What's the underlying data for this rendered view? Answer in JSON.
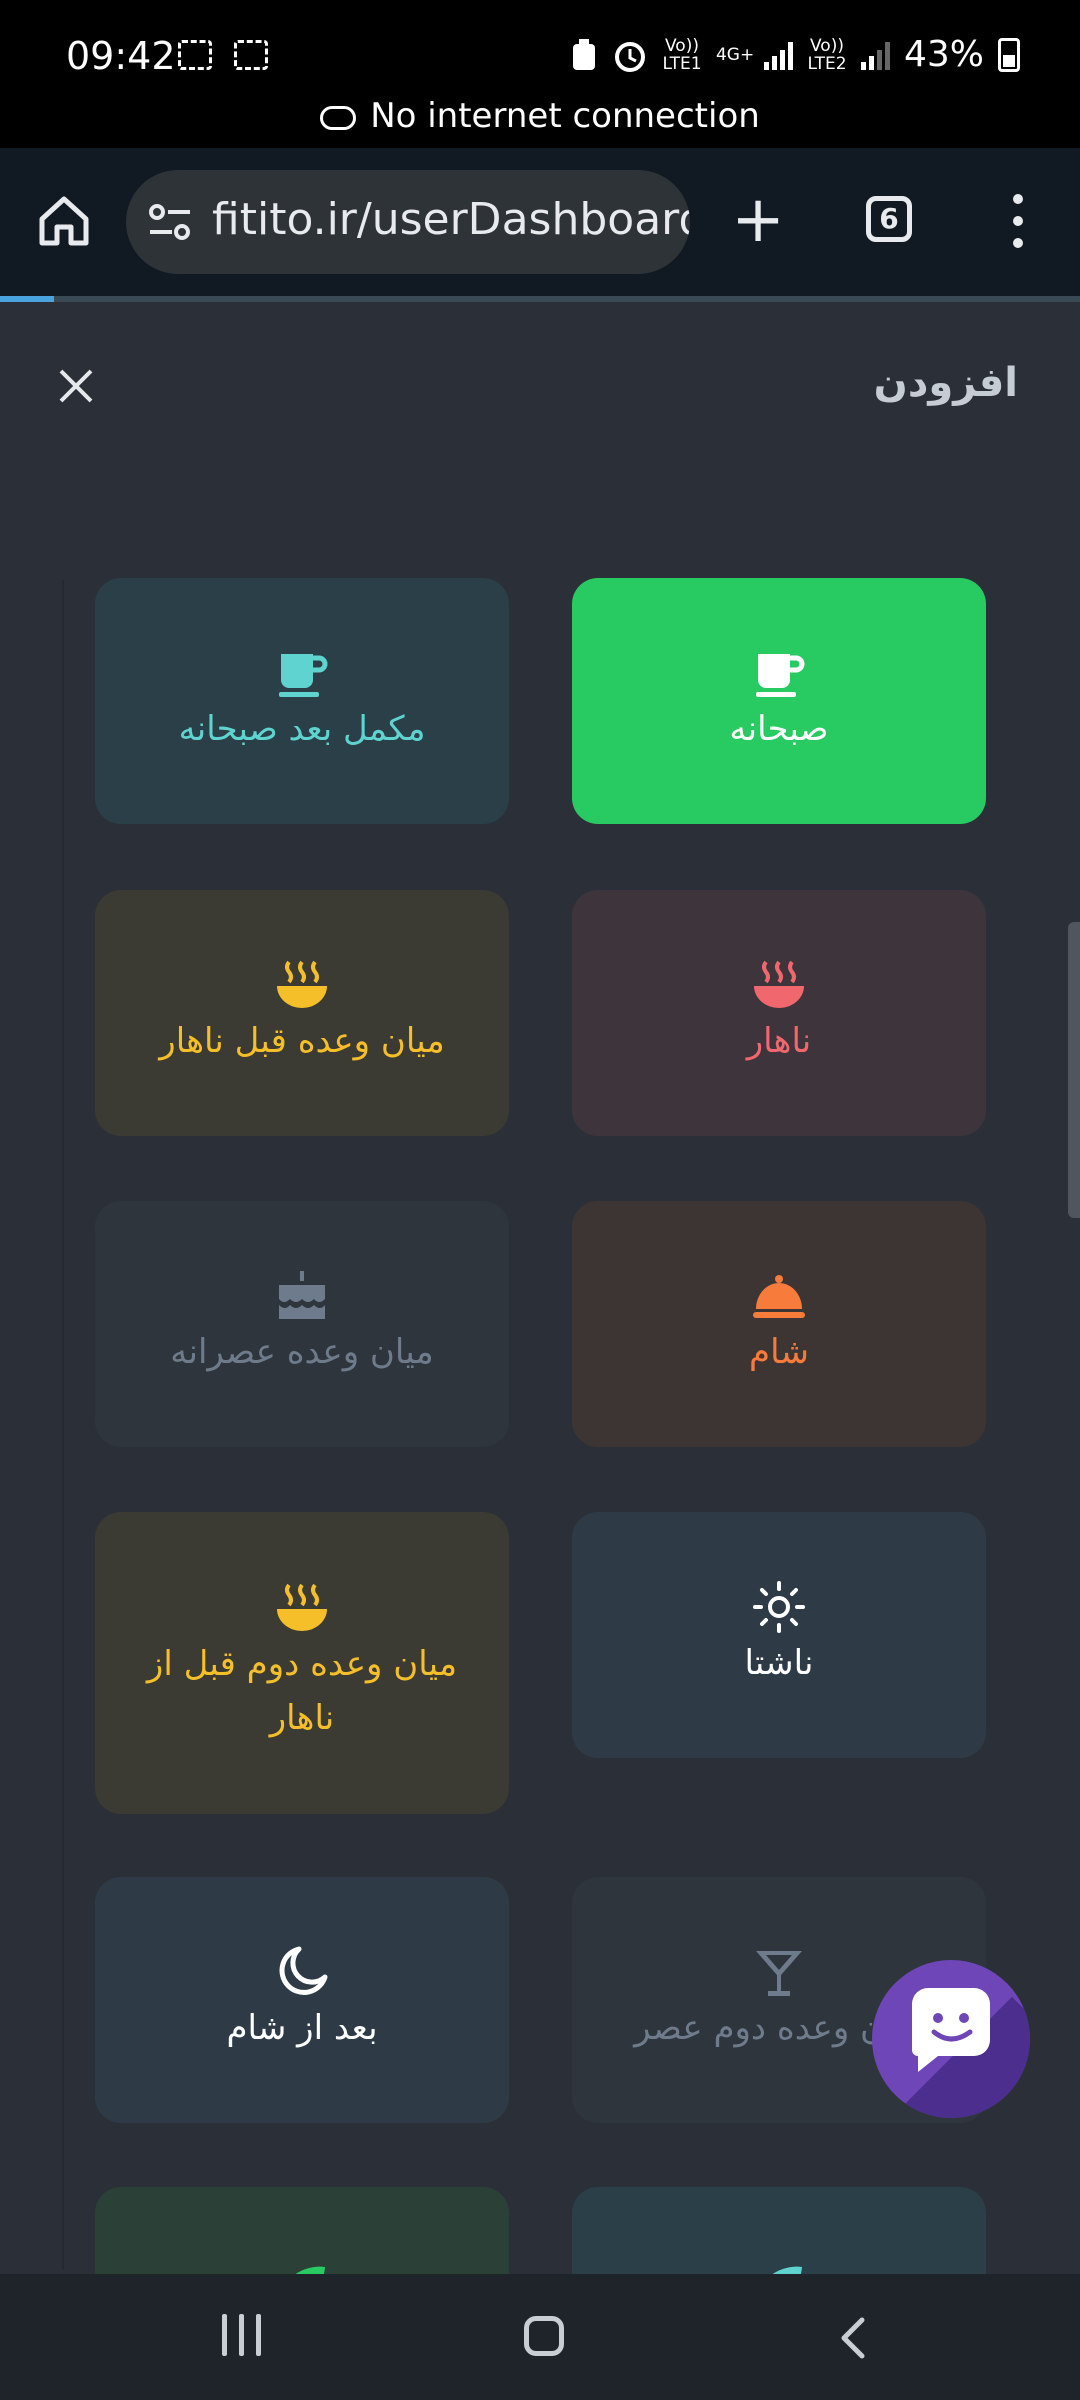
{
  "status_bar": {
    "time": "09:42",
    "net1": "Vo)) LTE1",
    "net_type": "4G+",
    "net2": "Vo)) LTE2",
    "battery": "43%",
    "banner": "No internet connection"
  },
  "browser": {
    "url": "fitito.ir/userDashboard",
    "tab_count": "6"
  },
  "modal": {
    "title": "افزودن"
  },
  "meals": [
    {
      "label": "صبحانه",
      "icon": "coffee-cup-icon"
    },
    {
      "label": "مکمل بعد صبحانه",
      "icon": "coffee-cup-icon"
    },
    {
      "label": "ناهار",
      "icon": "hot-bowl-icon"
    },
    {
      "label": "میان وعده قبل ناهار",
      "icon": "hot-bowl-icon"
    },
    {
      "label": "شام",
      "icon": "cloche-icon"
    },
    {
      "label": "میان وعده عصرانه",
      "icon": "cake-icon"
    },
    {
      "label": "ناشتا",
      "icon": "sun-icon"
    },
    {
      "label": "میان وعده دوم قبل از ناهار",
      "icon": "hot-bowl-icon"
    },
    {
      "label": "میان وعده دوم عصر",
      "icon": "cocktail-icon"
    },
    {
      "label": "بعد از شام",
      "icon": "moon-icon"
    }
  ],
  "colors": {
    "breakfast_bg": "#28cb62",
    "teal": "#5fd3cf",
    "red": "#f0676d",
    "amber": "#f5bf2a",
    "orange": "#f77b3b",
    "gray": "#6d7b8c",
    "chat": "#6e46b8"
  }
}
